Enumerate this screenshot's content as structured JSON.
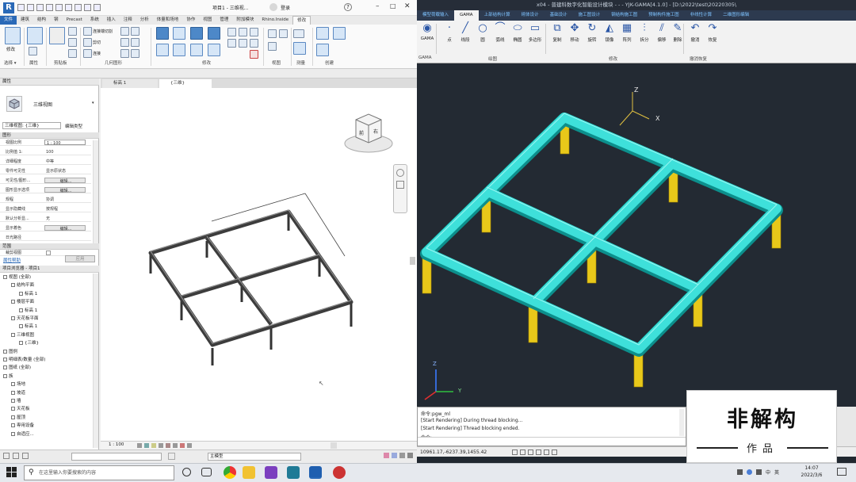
{
  "revit": {
    "title": "项目1 - 三维视...",
    "title_right": "登录",
    "tabs": [
      "文件",
      "建筑",
      "结构",
      "钢",
      "Precast",
      "系统",
      "插入",
      "注释",
      "分析",
      "体量和场地",
      "协作",
      "视图",
      "管理",
      "附加模块",
      "Rhino.Inside",
      "修改"
    ],
    "active_tab": "修改",
    "panels": [
      "选择 ▾",
      "属性",
      "剪贴板",
      "几何图形",
      "修改",
      "视图",
      "测量",
      "创建"
    ],
    "tool_labels": [
      "修改",
      "连接端切割",
      "剪切",
      "连接"
    ],
    "properties": {
      "header": "属性",
      "type_name": "三维视图",
      "view_selector": "三维视图: {三维}",
      "edit_type": "编辑类型",
      "section": "图形",
      "rows": [
        {
          "k": "视图比例",
          "v": "1 : 100",
          "btn": false
        },
        {
          "k": "比例值 1:",
          "v": "100",
          "btn": false
        },
        {
          "k": "详细程度",
          "v": "中等",
          "btn": false
        },
        {
          "k": "零件可见性",
          "v": "显示原状态",
          "btn": false
        },
        {
          "k": "可见性/图形...",
          "v": "编辑...",
          "btn": true
        },
        {
          "k": "图形显示选项",
          "v": "编辑...",
          "btn": true
        },
        {
          "k": "规程",
          "v": "协调",
          "btn": false
        },
        {
          "k": "显示隐藏线",
          "v": "按规程",
          "btn": false
        },
        {
          "k": "默认分析显...",
          "v": "无",
          "btn": false
        },
        {
          "k": "显示着色",
          "v": "编辑...",
          "btn": true
        },
        {
          "k": "日光路径",
          "v": "",
          "btn": false
        }
      ],
      "section2": "范围",
      "crop_row": "裁剪视图",
      "help_link": "属性帮助",
      "apply": "应用"
    },
    "browser": {
      "header": "项目浏览器 - 项目1",
      "items": [
        {
          "t": "视图 (全部)",
          "d": 0
        },
        {
          "t": "结构平面",
          "d": 1
        },
        {
          "t": "标高 1",
          "d": 2
        },
        {
          "t": "楼层平面",
          "d": 1
        },
        {
          "t": "标高 1",
          "d": 2
        },
        {
          "t": "天花板平面",
          "d": 1
        },
        {
          "t": "标高 1",
          "d": 2
        },
        {
          "t": "三维视图",
          "d": 1
        },
        {
          "t": "{三维}",
          "d": 2
        },
        {
          "t": "图例",
          "d": 0
        },
        {
          "t": "明细表/数量 (全部)",
          "d": 0
        },
        {
          "t": "图纸 (全部)",
          "d": 0
        },
        {
          "t": "族",
          "d": 0
        },
        {
          "t": "场地",
          "d": 1
        },
        {
          "t": "坡道",
          "d": 1
        },
        {
          "t": "墙",
          "d": 1
        },
        {
          "t": "天花板",
          "d": 1
        },
        {
          "t": "屋顶",
          "d": 1
        },
        {
          "t": "専用设备",
          "d": 1
        },
        {
          "t": "自适应...",
          "d": 1
        }
      ]
    },
    "view_tabs": [
      "标高 1",
      "{三维}"
    ],
    "viewcube_front": "前",
    "viewcube_right": "右",
    "scale": "1 : 100",
    "bottom_model": "主模型"
  },
  "cad": {
    "title": "x04 - 普建科数字化智能设计模块 - - - YJK-GAMA[4.1.0]  - [D:\\2022\\test\\20220305\\",
    "tabs": [
      "模型荷载输入",
      "GAMA",
      "上部结构计算",
      "砌体设计",
      "基础设计",
      "施工图设计",
      "钢结构施工图",
      "预制构件施工图",
      "非线性计算",
      "二维图形编辑"
    ],
    "active_tab": "GAMA",
    "tools": [
      "GAMA",
      "点",
      "线段",
      "圆",
      "弧线",
      "椭圆",
      "多边形",
      "复制",
      "移动",
      "旋转",
      "镜像",
      "阵列",
      "拆分",
      "偏移",
      "删除",
      "撤消",
      "恢复"
    ],
    "groups": [
      "GAMA",
      "绘图",
      "修改",
      "撤消恢复"
    ],
    "axes": {
      "x": "X",
      "y": "Y",
      "z": "Z"
    },
    "cmd_lines": [
      "命令:pgw_ml",
      "[Start Rendering] During thread blocking...",
      "[Start Rendering] Thread blocking ended.",
      "命令:"
    ],
    "coords": "10961.17,-6237.39,1455.42"
  },
  "brand": {
    "name": "非解构",
    "sub": "作品"
  },
  "taskbar": {
    "search_placeholder": "在这里输入你要搜索的内容",
    "time": "14:07",
    "date": "2022/3/6",
    "lang": "中",
    "ime": "英"
  }
}
